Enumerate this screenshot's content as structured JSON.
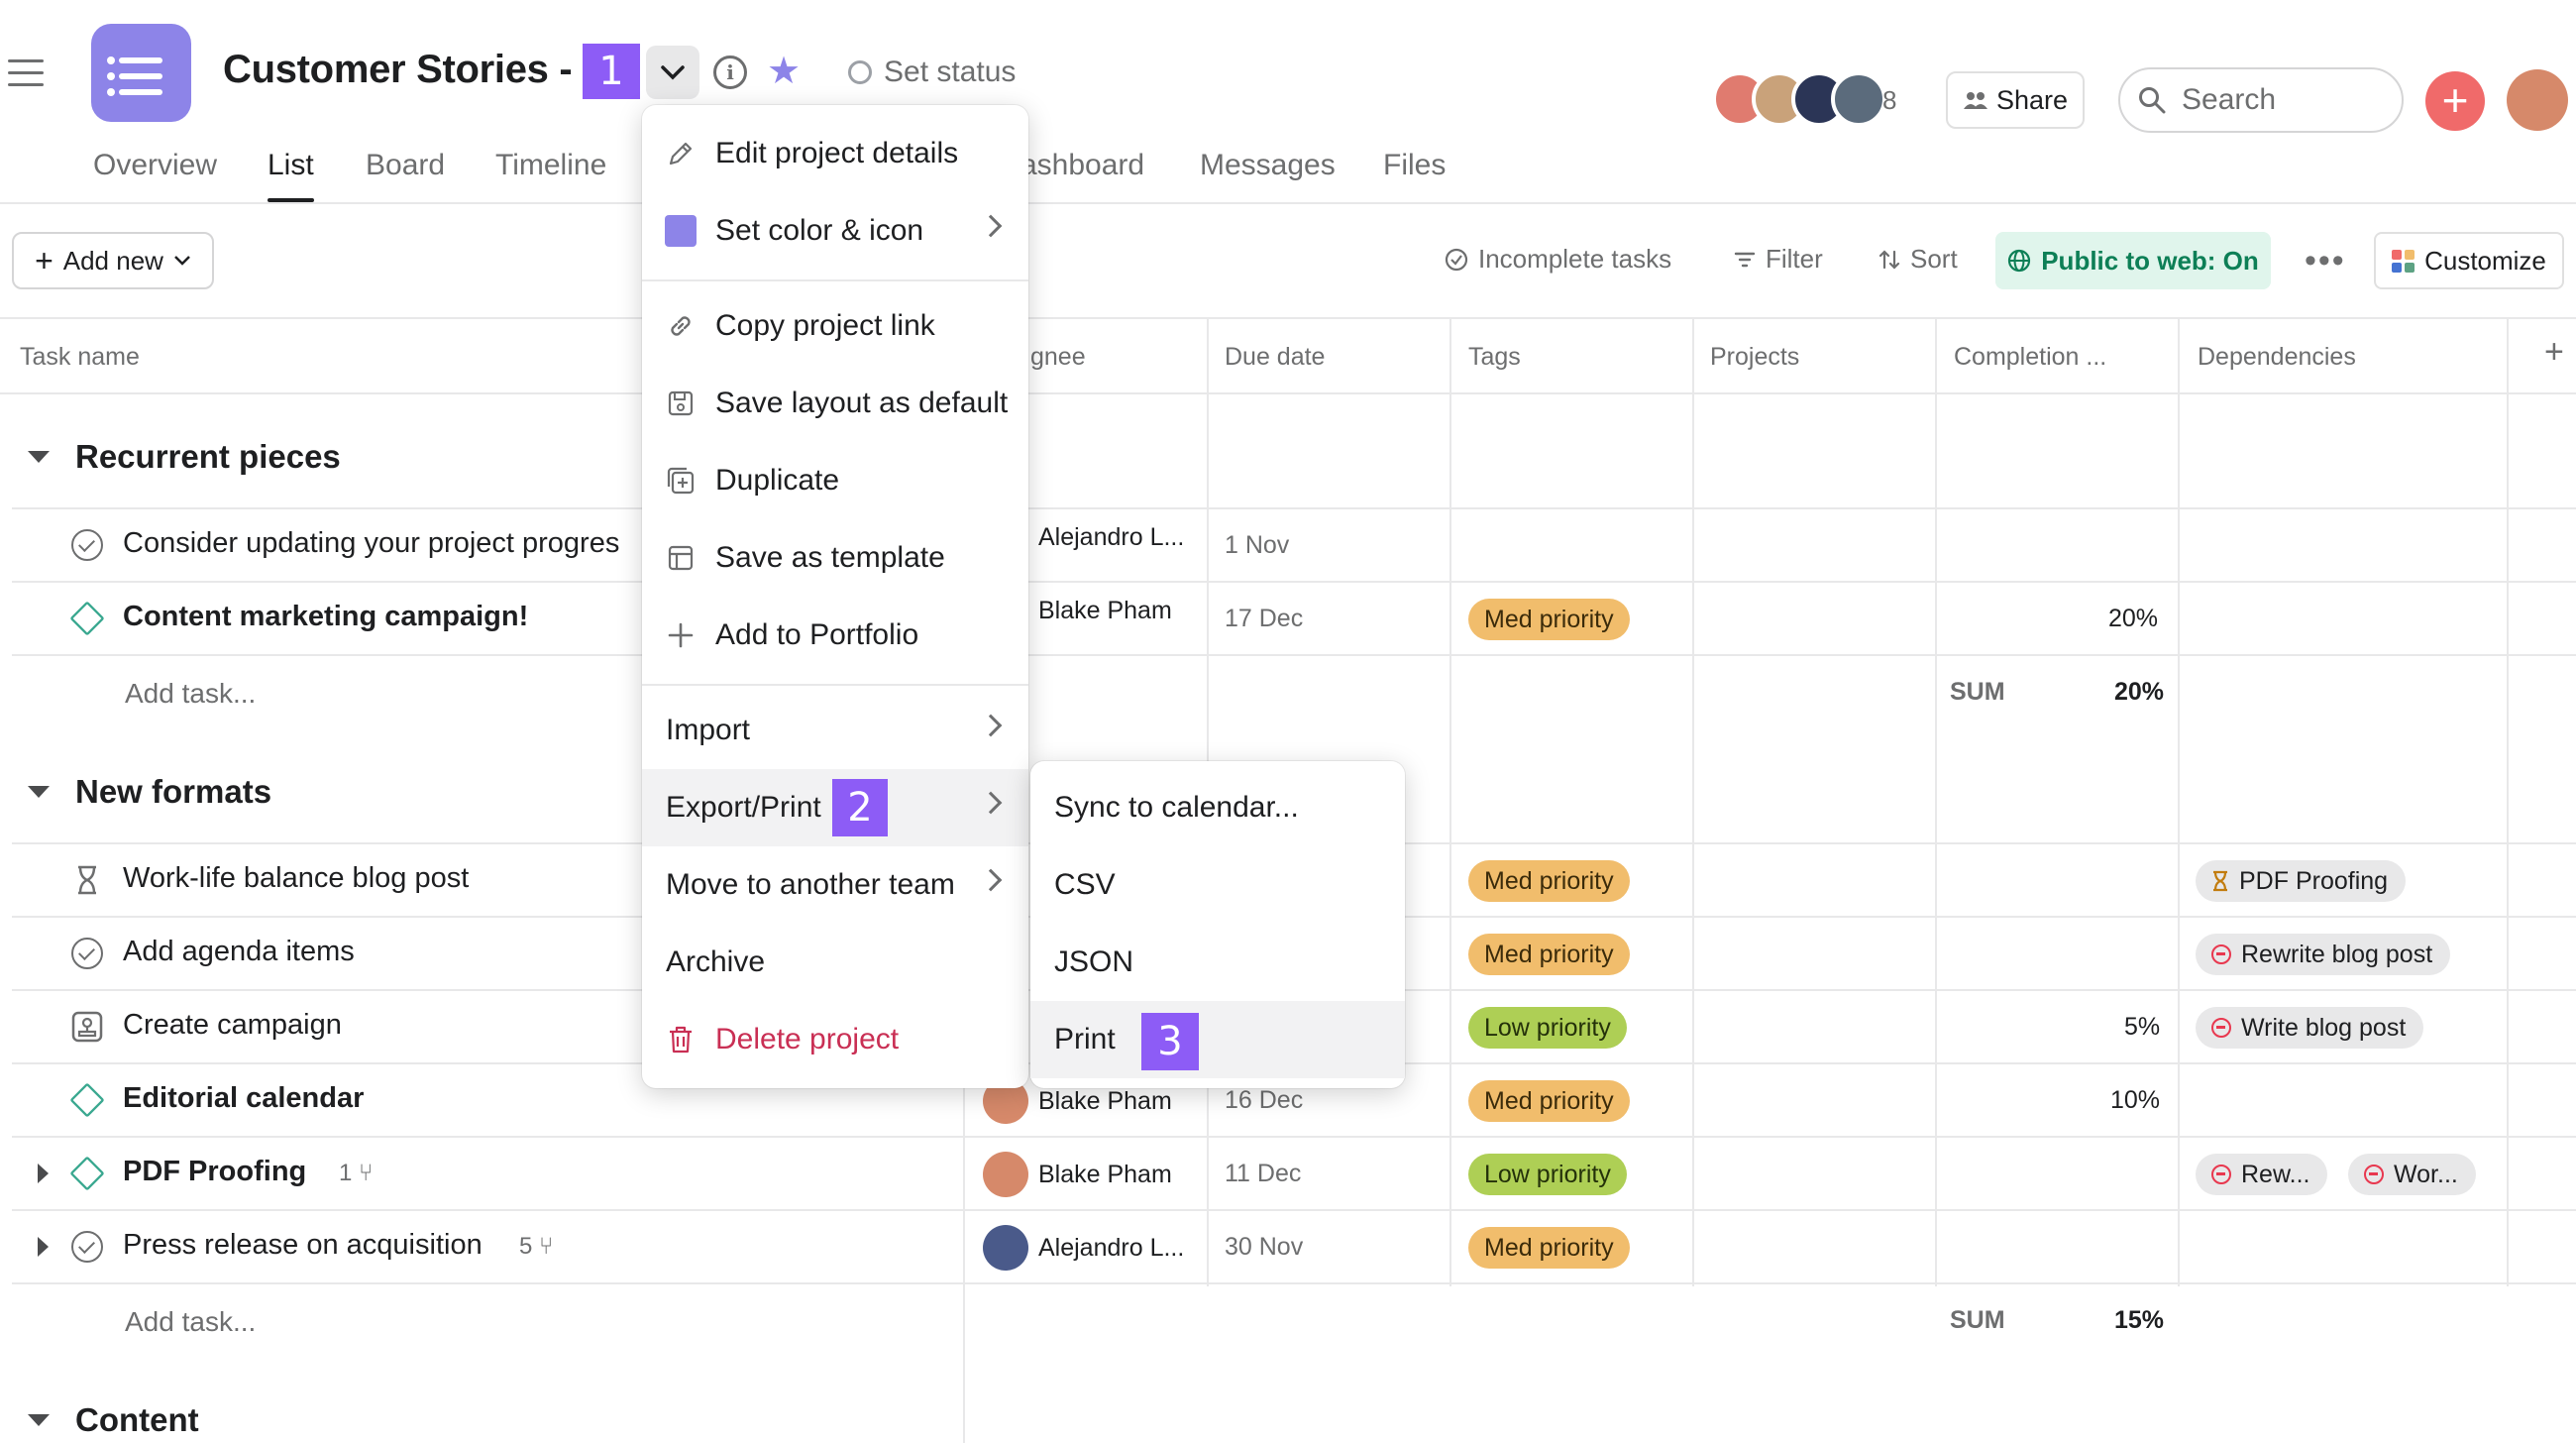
{
  "header": {
    "project_title": "Customer Stories - C",
    "set_status_label": "Set status",
    "member_count": "8",
    "share_label": "Share",
    "search_placeholder": "Search",
    "avatar_colors": [
      "#e07b6f",
      "#c9a27a",
      "#2b3556",
      "#5b6b7c"
    ],
    "icon_color": "#8d84e8"
  },
  "tabs": [
    "Overview",
    "List",
    "Board",
    "Timeline",
    "ashboard",
    "Messages",
    "Files"
  ],
  "active_tab": "List",
  "step_badges": [
    "1",
    "2",
    "3"
  ],
  "toolbar": {
    "add_new": "Add new",
    "incomplete": "Incomplete tasks",
    "filter": "Filter",
    "sort": "Sort",
    "public": "Public to web: On",
    "customize": "Customize"
  },
  "columns": [
    "Task name",
    "gnee",
    "Due date",
    "Tags",
    "Projects",
    "Completion ...",
    "Dependencies"
  ],
  "sections": [
    {
      "title": "Recurrent pieces",
      "tasks": [
        {
          "name": "Consider updating your project progres",
          "assignee": "Alejandro L...",
          "due": "1 Nov",
          "tag": "",
          "completion": "",
          "deps": []
        },
        {
          "name": "Content marketing campaign!",
          "assignee": "Blake Pham",
          "due": "17 Dec",
          "tag": "Med priority",
          "completion": "20%",
          "deps": []
        }
      ],
      "add_task": "Add task...",
      "sum_label": "SUM",
      "sum_value": "20%"
    },
    {
      "title": "New formats",
      "tasks": [
        {
          "name": "Work-life balance blog post",
          "tag": "Med priority",
          "deps": [
            "PDF Proofing"
          ]
        },
        {
          "name": "Add agenda items",
          "tag": "Med priority",
          "deps": [
            "Rewrite blog post"
          ]
        },
        {
          "name": "Create campaign",
          "tag": "Low priority",
          "completion": "5%",
          "deps": [
            "Write blog post"
          ]
        },
        {
          "name": "Editorial calendar",
          "assignee": "Blake Pham",
          "due": "16 Dec",
          "tag": "Med priority",
          "completion": "10%",
          "deps": []
        },
        {
          "name": "PDF Proofing",
          "subtasks": "1",
          "assignee": "Blake Pham",
          "due": "11 Dec",
          "tag": "Low priority",
          "deps": [
            "Rew...",
            "Wor..."
          ]
        },
        {
          "name": "Press release on acquisition",
          "subtasks": "5",
          "assignee": "Alejandro L...",
          "due": "30 Nov",
          "tag": "Med priority",
          "deps": []
        }
      ],
      "add_task": "Add task...",
      "sum_label": "SUM",
      "sum_value": "15%"
    },
    {
      "title": "Content"
    }
  ],
  "project_menu": {
    "items": [
      "Edit project details",
      "Set color & icon",
      "Copy project link",
      "Save layout as default",
      "Duplicate",
      "Save as template",
      "Add to Portfolio",
      "Import",
      "Export/Print",
      "Move to another team",
      "Archive",
      "Delete project"
    ]
  },
  "export_submenu": {
    "items": [
      "Sync to calendar...",
      "CSV",
      "JSON",
      "Print"
    ]
  }
}
